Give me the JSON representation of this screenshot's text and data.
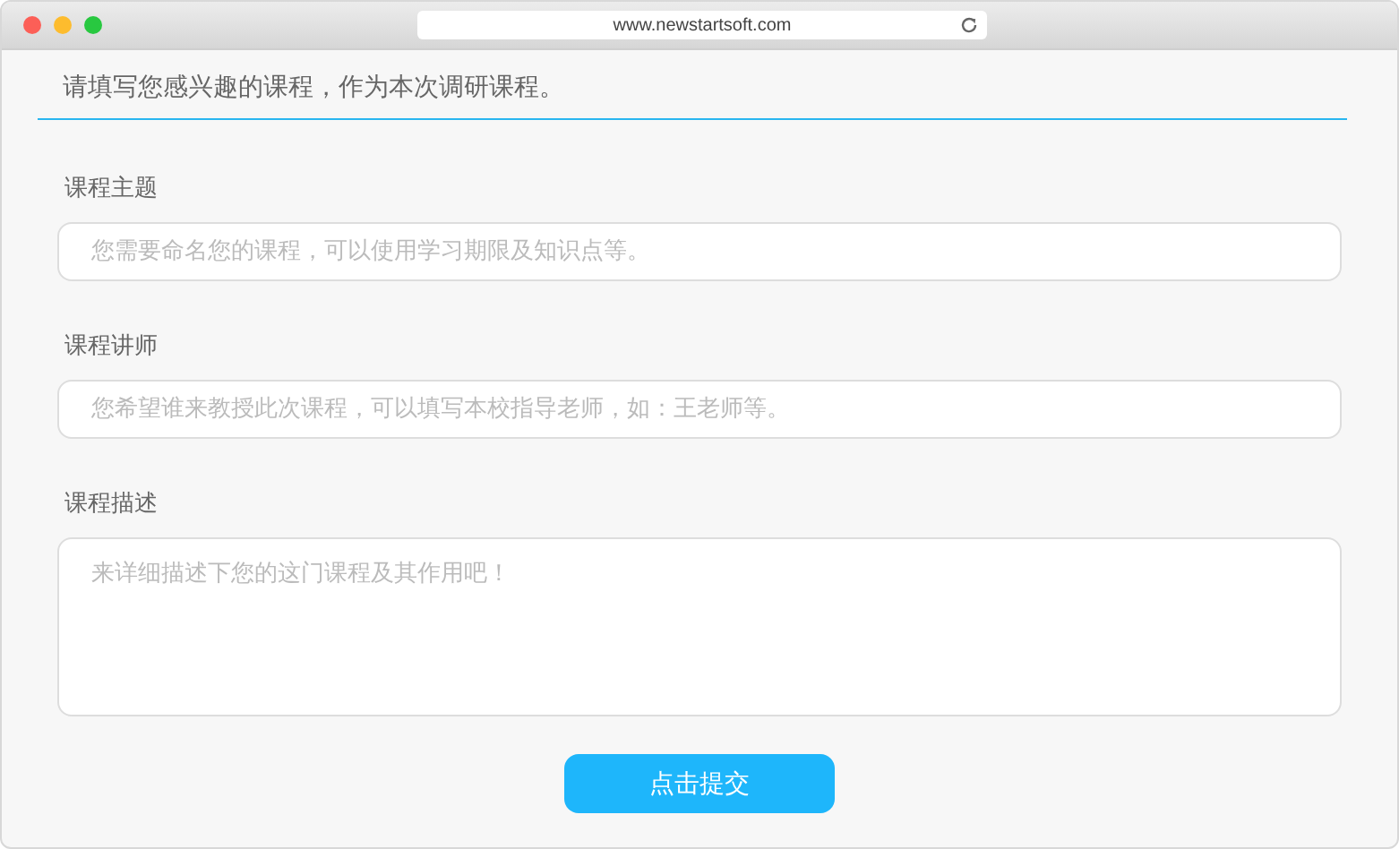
{
  "browser": {
    "address": "www.newstartsoft.com"
  },
  "heading": "请填写您感兴趣的课程，作为本次调研课程。",
  "fields": [
    {
      "kind": "input",
      "label": "课程主题",
      "placeholder": "您需要命名您的课程，可以使用学习期限及知识点等。"
    },
    {
      "kind": "input",
      "label": "课程讲师",
      "placeholder": "您希望谁来教授此次课程，可以填写本校指导老师，如：王老师等。"
    },
    {
      "kind": "textarea",
      "label": "课程描述",
      "placeholder": "来详细描述下您的这门课程及其作用吧！"
    }
  ],
  "submit": "点击提交"
}
